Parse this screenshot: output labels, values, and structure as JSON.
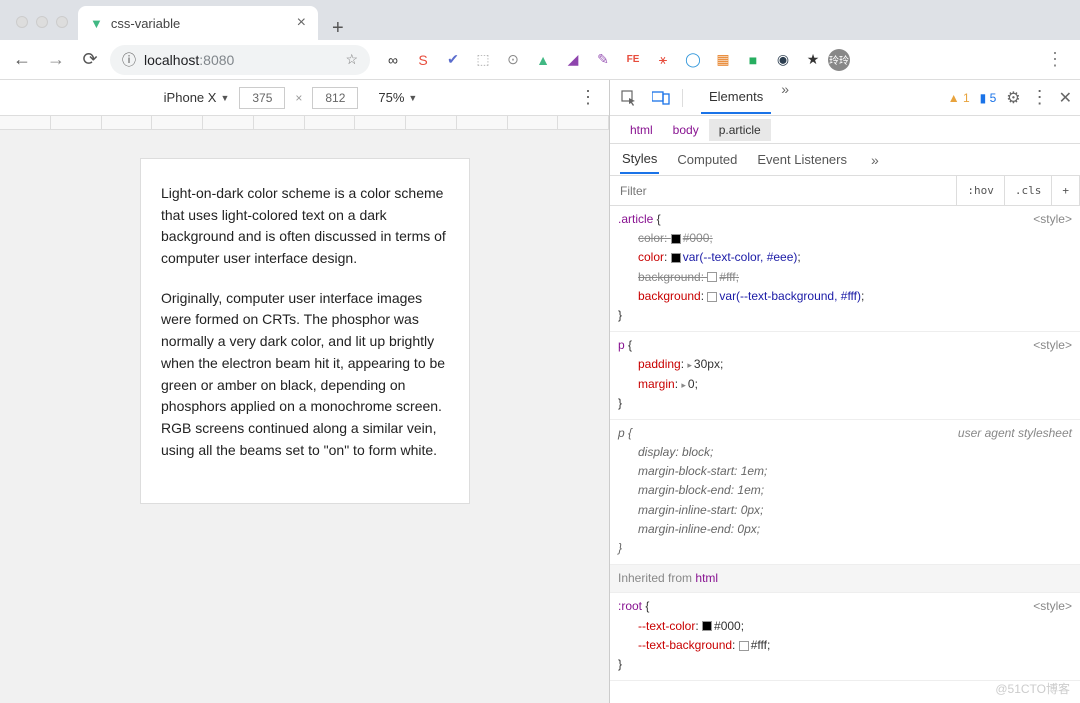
{
  "tab": {
    "title": "css-variable"
  },
  "url": {
    "info": "ⓘ",
    "host": "localhost",
    "port": ":8080"
  },
  "extensions": [
    "∞",
    "S",
    "✔",
    "⬚",
    "⊙",
    "▲",
    "◢",
    "✎",
    "FE",
    "⚹",
    "◯",
    "▦",
    "■",
    "◉",
    "★"
  ],
  "avatar": "玲玲",
  "device": {
    "name": "iPhone X",
    "width": "375",
    "height": "812",
    "zoom": "75%"
  },
  "article": {
    "p1": "Light-on-dark color scheme is a color scheme that uses light-colored text on a dark background and is often discussed in terms of computer user interface design.",
    "p2": "Originally, computer user interface images were formed on CRTs. The phosphor was normally a very dark color, and lit up brightly when the electron beam hit it, appearing to be green or amber on black, depending on phosphors applied on a monochrome screen. RGB screens continued along a similar vein, using all the beams set to \"on\" to form white."
  },
  "devtools": {
    "tabs": {
      "elements": "Elements"
    },
    "warnings": "1",
    "infos": "5",
    "crumbs": {
      "html": "html",
      "body": "body",
      "article": "p.article"
    },
    "styleTabs": {
      "styles": "Styles",
      "computed": "Computed",
      "listeners": "Event Listeners"
    },
    "filter": {
      "placeholder": "Filter",
      "hov": ":hov",
      "cls": ".cls",
      "plus": "+"
    },
    "rule1": {
      "selector": ".article",
      "src": "<style>",
      "d1p": "color",
      "d1v": "#000",
      "d2p": "color",
      "d2v": "var(--text-color, #eee)",
      "d3p": "background",
      "d3v": "#fff",
      "d4p": "background",
      "d4v": "var(--text-background, #fff)"
    },
    "rule2": {
      "selector": "p",
      "src": "<style>",
      "d1p": "padding",
      "d1v": "30px",
      "d2p": "margin",
      "d2v": "0"
    },
    "rule3": {
      "selector": "p",
      "src": "user agent stylesheet",
      "d1p": "display",
      "d1v": "block",
      "d2p": "margin-block-start",
      "d2v": "1em",
      "d3p": "margin-block-end",
      "d3v": "1em",
      "d4p": "margin-inline-start",
      "d4v": "0px",
      "d5p": "margin-inline-end",
      "d5v": "0px"
    },
    "inherited": {
      "label": "Inherited from",
      "from": "html"
    },
    "rule4": {
      "selector": ":root",
      "src": "<style>",
      "d1p": "--text-color",
      "d1v": "#000",
      "d2p": "--text-background",
      "d2v": "#fff"
    }
  },
  "watermark": "@51CTO博客"
}
